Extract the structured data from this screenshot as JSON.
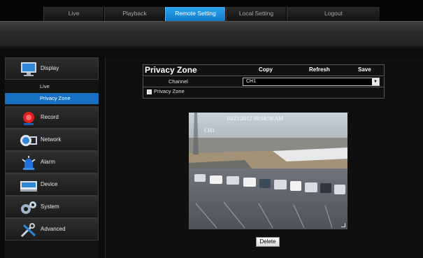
{
  "nav": {
    "tabs": [
      {
        "label": "Live"
      },
      {
        "label": "Playback"
      },
      {
        "label": "Remote Setting",
        "active": true
      },
      {
        "label": "Local Setting"
      },
      {
        "label": "Logout"
      }
    ]
  },
  "sidebar": {
    "display": {
      "label": "Display",
      "icon": "monitor-icon"
    },
    "sub_items": [
      {
        "label": "Live"
      },
      {
        "label": "Privacy Zone",
        "active": true
      }
    ],
    "record": {
      "label": "Record",
      "icon": "record-icon"
    },
    "network": {
      "label": "Network",
      "icon": "network-icon"
    },
    "alarm": {
      "label": "Alarm",
      "icon": "alarm-icon"
    },
    "device": {
      "label": "Device",
      "icon": "device-icon"
    },
    "system": {
      "label": "System",
      "icon": "system-gears-icon"
    },
    "advanced": {
      "label": "Advanced",
      "icon": "tools-icon"
    }
  },
  "panel": {
    "title": "Privacy Zone",
    "copy_label": "Copy",
    "refresh_label": "Refresh",
    "save_label": "Save",
    "channel_label": "Channel",
    "channel_value": "CH1",
    "privacy_zone_checkbox_label": "Privacy Zone",
    "privacy_zone_checked": false
  },
  "video": {
    "timestamp": "10/21/2012 09:58:58 AM",
    "channel": "CH1"
  },
  "delete_label": "Delete",
  "colors": {
    "accent_blue": "#1670c2",
    "nav_active": "#1e8fe0",
    "background": "#0c0c0c"
  }
}
